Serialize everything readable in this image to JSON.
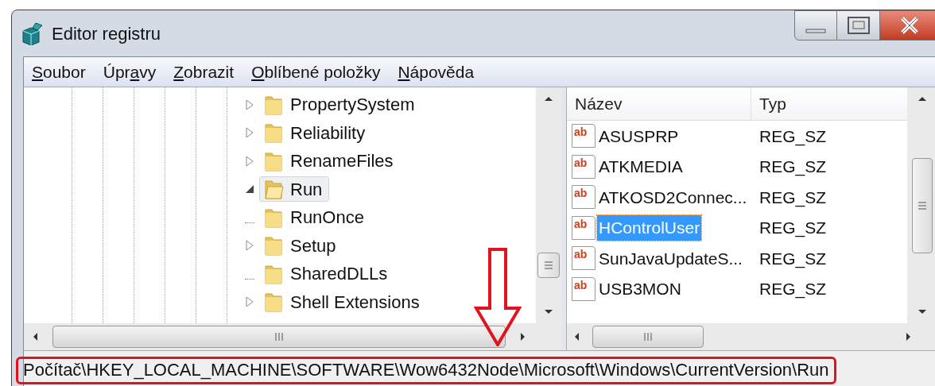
{
  "window": {
    "title": "Editor registru"
  },
  "menu": [
    {
      "accel": "S",
      "rest": "oubor"
    },
    {
      "lead": "Úpr",
      "accel": "a",
      "rest": "vy"
    },
    {
      "accel": "Z",
      "rest": "obrazit"
    },
    {
      "accel": "O",
      "rest": "blíbené položky"
    },
    {
      "accel": "N",
      "rest": "ápověda"
    }
  ],
  "tree": {
    "items": [
      {
        "label": "PropertySystem",
        "has_children": true,
        "expanded": false,
        "selected": false
      },
      {
        "label": "Reliability",
        "has_children": true,
        "expanded": false,
        "selected": false
      },
      {
        "label": "RenameFiles",
        "has_children": true,
        "expanded": false,
        "selected": false
      },
      {
        "label": "Run",
        "has_children": true,
        "expanded": true,
        "selected": true
      },
      {
        "label": "RunOnce",
        "has_children": false,
        "expanded": false,
        "selected": false
      },
      {
        "label": "Setup",
        "has_children": true,
        "expanded": false,
        "selected": false
      },
      {
        "label": "SharedDLLs",
        "has_children": false,
        "expanded": false,
        "selected": false
      },
      {
        "label": "Shell Extensions",
        "has_children": true,
        "expanded": false,
        "selected": false
      }
    ]
  },
  "values": {
    "columns": [
      "Název",
      "Typ"
    ],
    "rows": [
      {
        "icon_label": "ab",
        "name": "ASUSPRP",
        "type": "REG_SZ",
        "selected": false
      },
      {
        "icon_label": "ab",
        "name": "ATKMEDIA",
        "type": "REG_SZ",
        "selected": false
      },
      {
        "icon_label": "ab",
        "name": "ATKOSD2Connec...",
        "type": "REG_SZ",
        "selected": false
      },
      {
        "icon_label": "ab",
        "name": "HControlUser",
        "type": "REG_SZ",
        "selected": true
      },
      {
        "icon_label": "ab",
        "name": "SunJavaUpdateS...",
        "type": "REG_SZ",
        "selected": false
      },
      {
        "icon_label": "ab",
        "name": "USB3MON",
        "type": "REG_SZ",
        "selected": false
      }
    ]
  },
  "status_bar": "Počítač\\HKEY_LOCAL_MACHINE\\SOFTWARE\\Wow6432Node\\Microsoft\\Windows\\CurrentVersion\\Run"
}
